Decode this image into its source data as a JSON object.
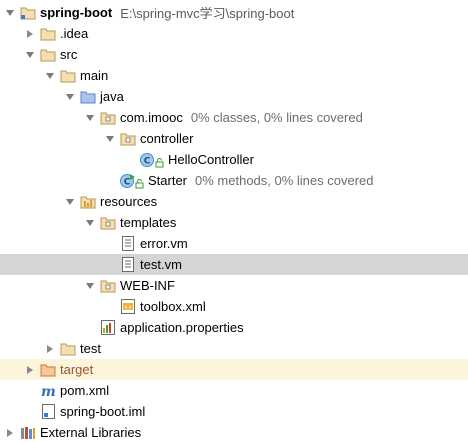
{
  "project": {
    "name": "spring-boot",
    "path": "E:\\spring-mvc学习\\spring-boot"
  },
  "tree": {
    "idea": ".idea",
    "src": "src",
    "main": "main",
    "java": "java",
    "package": "com.imooc",
    "package_coverage": "0% classes, 0% lines covered",
    "controller": "controller",
    "hello_controller": "HelloController",
    "starter": "Starter",
    "starter_coverage": "0% methods, 0% lines covered",
    "resources": "resources",
    "templates": "templates",
    "error_vm": "error.vm",
    "test_vm": "test.vm",
    "web_inf": "WEB-INF",
    "toolbox_xml": "toolbox.xml",
    "application_properties": "application.properties",
    "test": "test",
    "target": "target",
    "pom_xml": "pom.xml",
    "iml": "spring-boot.iml",
    "external_libraries": "External Libraries"
  },
  "colors": {
    "selected_row": "#d5d5d5",
    "highlight_row": "#fbf5dc",
    "folder": "#dcb67a",
    "class_icon": "#3f8fd2"
  }
}
